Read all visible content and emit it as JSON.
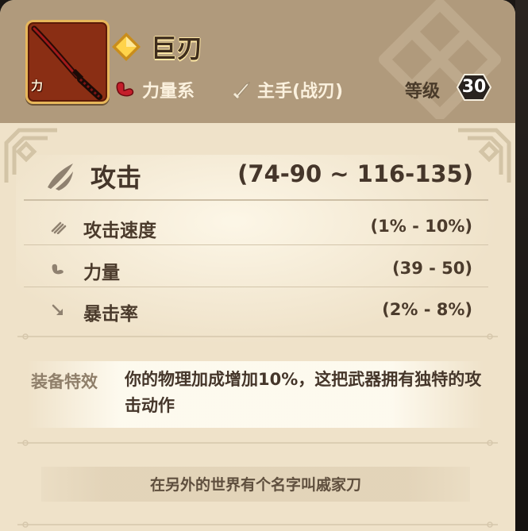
{
  "item": {
    "name": "巨刃",
    "type_badge": "力",
    "rarity_icon": "diamond-icon",
    "weapon_icon": "katana-icon",
    "class_label": "力量系",
    "class_icon": "flexed-arm-icon",
    "slot_label": "主手(战刃)",
    "slot_icon": "sword-icon",
    "level_label": "等级",
    "level_value": "30"
  },
  "attack": {
    "label": "攻击",
    "value": "(74-90 ~ 116-135)",
    "icon": "attack-slash-icon"
  },
  "stats": [
    {
      "label": "攻击速度",
      "value": "(1% - 10%)",
      "icon": "attack-speed-icon"
    },
    {
      "label": "力量",
      "value": "(39 - 50)",
      "icon": "strength-icon"
    },
    {
      "label": "暴击率",
      "value": "(2% - 8%)",
      "icon": "crit-rate-icon"
    }
  ],
  "effect": {
    "label": "装备特效",
    "text": "你的物理加成增加10%，这把武器拥有独特的攻击动作"
  },
  "lore": "在另外的世界有个名字叫戚家刀",
  "colors": {
    "header_bg": "#b09a7c",
    "body_bg": "#efe2c9",
    "frame_border": "#e7b75b",
    "icon_bg": "#8a2e14",
    "text_dark": "#45362a"
  }
}
